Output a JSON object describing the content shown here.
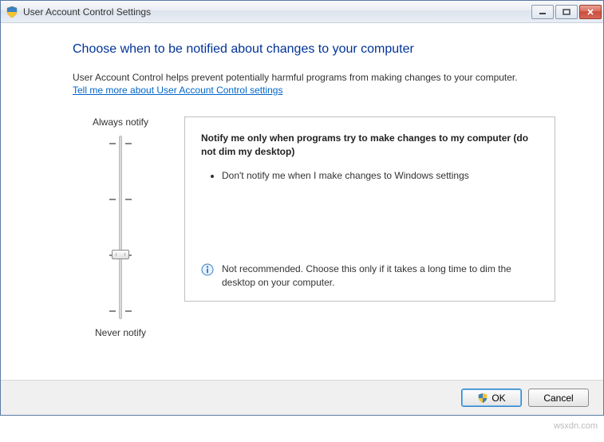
{
  "titlebar": {
    "title": "User Account Control Settings"
  },
  "heading": "Choose when to be notified about changes to your computer",
  "intro": "User Account Control helps prevent potentially harmful programs from making changes to your computer.",
  "link_text": "Tell me more about User Account Control settings",
  "slider": {
    "top_label": "Always notify",
    "bottom_label": "Never notify",
    "levels": 4,
    "selected_index": 2
  },
  "description": {
    "title": "Notify me only when programs try to make changes to my computer (do not dim my desktop)",
    "bullets": [
      "Don't notify me when I make changes to Windows settings"
    ],
    "footer": "Not recommended. Choose this only if it takes a long time to dim the desktop on your computer."
  },
  "buttons": {
    "ok": "OK",
    "cancel": "Cancel"
  },
  "watermark": "wsxdn.com"
}
